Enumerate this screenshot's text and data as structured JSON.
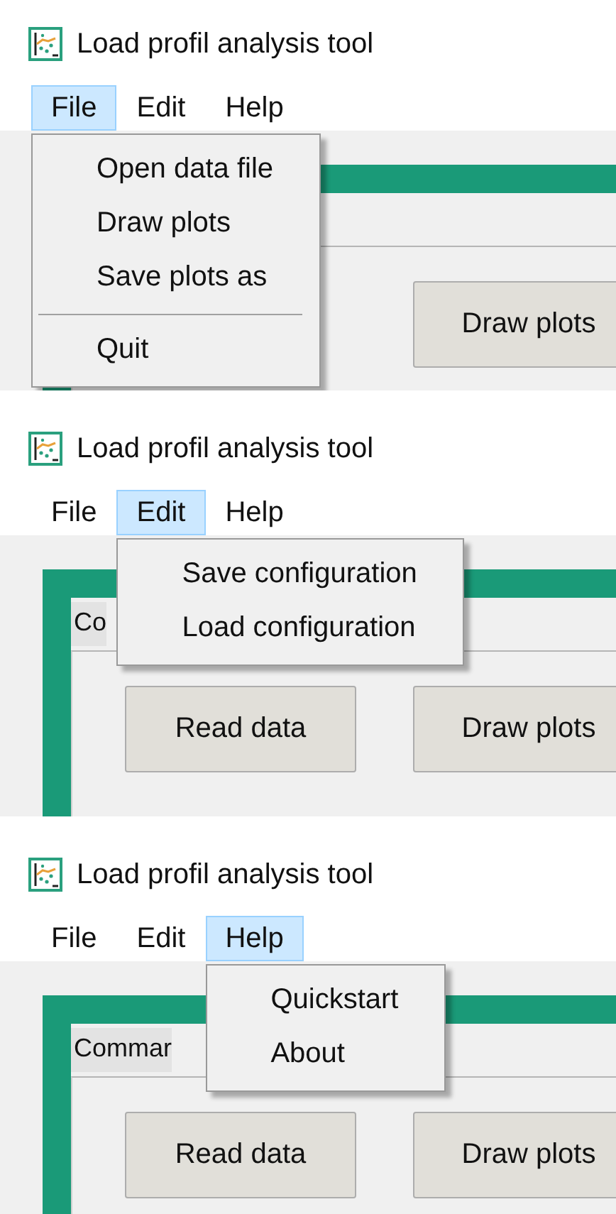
{
  "panels": [
    {
      "title": "Load profil analysis tool",
      "menus": [
        {
          "label": "File",
          "selected": true,
          "items": [
            {
              "kind": "item",
              "label": "Open data file"
            },
            {
              "kind": "item",
              "label": "Draw plots"
            },
            {
              "kind": "item",
              "label": "Save plots as"
            },
            {
              "kind": "separator"
            },
            {
              "kind": "item",
              "label": "Quit"
            }
          ]
        },
        {
          "label": "Edit",
          "selected": false
        },
        {
          "label": "Help",
          "selected": false
        }
      ],
      "buttons": [
        "Draw plots"
      ]
    },
    {
      "title": "Load profil analysis tool",
      "menus": [
        {
          "label": "File",
          "selected": false
        },
        {
          "label": "Edit",
          "selected": true,
          "items": [
            {
              "kind": "item",
              "label": "Save configuration"
            },
            {
              "kind": "item",
              "label": "Load configuration"
            }
          ]
        },
        {
          "label": "Help",
          "selected": false
        }
      ],
      "group_label": "Co",
      "buttons": [
        "Read data",
        "Draw plots"
      ]
    },
    {
      "title": "Load profil analysis tool",
      "menus": [
        {
          "label": "File",
          "selected": false
        },
        {
          "label": "Edit",
          "selected": false
        },
        {
          "label": "Help",
          "selected": true,
          "items": [
            {
              "kind": "item",
              "label": "Quickstart"
            },
            {
              "kind": "item",
              "label": "About"
            }
          ]
        }
      ],
      "group_label": "Commar",
      "buttons": [
        "Read data",
        "Draw plots"
      ]
    }
  ]
}
